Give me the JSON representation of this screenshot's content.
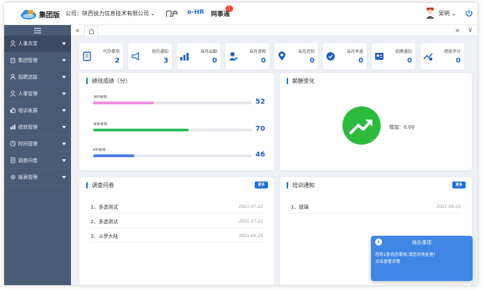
{
  "header": {
    "brand": "集团版",
    "company": "公司：陕西锐力信息技术有限公司",
    "nav": [
      {
        "label": "门户"
      },
      {
        "label": "e-HR"
      },
      {
        "label": "网事通"
      }
    ],
    "badge_count": "1",
    "user_name": "吴明",
    "colors": {
      "active": "#1e6fd9",
      "badge": "#ff3b30"
    }
  },
  "sidebar": {
    "items": [
      {
        "label": "人事共享",
        "icon": "user-icon"
      },
      {
        "label": "集团管理",
        "icon": "building-icon"
      },
      {
        "label": "招聘选拔",
        "icon": "person-icon"
      },
      {
        "label": "人事管理",
        "icon": "user-icon"
      },
      {
        "label": "培训发展",
        "icon": "thumb-icon"
      },
      {
        "label": "绩效管理",
        "icon": "chart-icon"
      },
      {
        "label": "时间管理",
        "icon": "clock-icon"
      },
      {
        "label": "调查问卷",
        "icon": "doc-icon"
      },
      {
        "label": "报表管理",
        "icon": "gear-icon"
      }
    ]
  },
  "stats": [
    {
      "label": "代办事项",
      "value": "2",
      "icon": "todo-icon"
    },
    {
      "label": "我的通知",
      "value": "3",
      "icon": "megaphone-icon"
    },
    {
      "label": "当月出勤",
      "value": "0",
      "icon": "bar-chart-icon"
    },
    {
      "label": "当月请假",
      "value": "0",
      "icon": "user-leave-icon"
    },
    {
      "label": "当月迟到",
      "value": "0",
      "icon": "location-icon"
    },
    {
      "label": "当月早退",
      "value": "0",
      "icon": "badge-icon"
    },
    {
      "label": "招聘通知",
      "value": "0",
      "icon": "id-card-icon"
    },
    {
      "label": "绩效评分",
      "value": "0",
      "icon": "trend-icon"
    }
  ],
  "performance": {
    "title": "绩效成绩（分）",
    "items": [
      {
        "label": "360考核",
        "value": "52",
        "fraction": 0.38,
        "color": "#f08be0"
      },
      {
        "label": "目标考核",
        "value": "70",
        "fraction": 0.6,
        "color": "#2dbb5e"
      },
      {
        "label": "KPI考核",
        "value": "46",
        "fraction": 0.26,
        "color": "#4a7ee0"
      }
    ]
  },
  "salary": {
    "title": "薪酬变化",
    "text": "增加：0.00",
    "color": "#2dbb3e"
  },
  "survey": {
    "title": "调查问卷",
    "more": "更多",
    "items": [
      {
        "text": "1、多选测试",
        "date": "2021-07-22"
      },
      {
        "text": "2、多选测试",
        "date": "2021-07-21"
      },
      {
        "text": "3、斗罗大陆",
        "date": "2021-06-25"
      }
    ]
  },
  "training": {
    "title": "培训通知",
    "more": "更多",
    "items": [
      {
        "text": "1、珉璃",
        "date": "2021-06-25"
      }
    ]
  },
  "toast": {
    "title": "待办事项",
    "line1": "您有2条待办事项,请您尽快处理！",
    "line2": "点击查看详情",
    "color": "#3f86e5"
  }
}
